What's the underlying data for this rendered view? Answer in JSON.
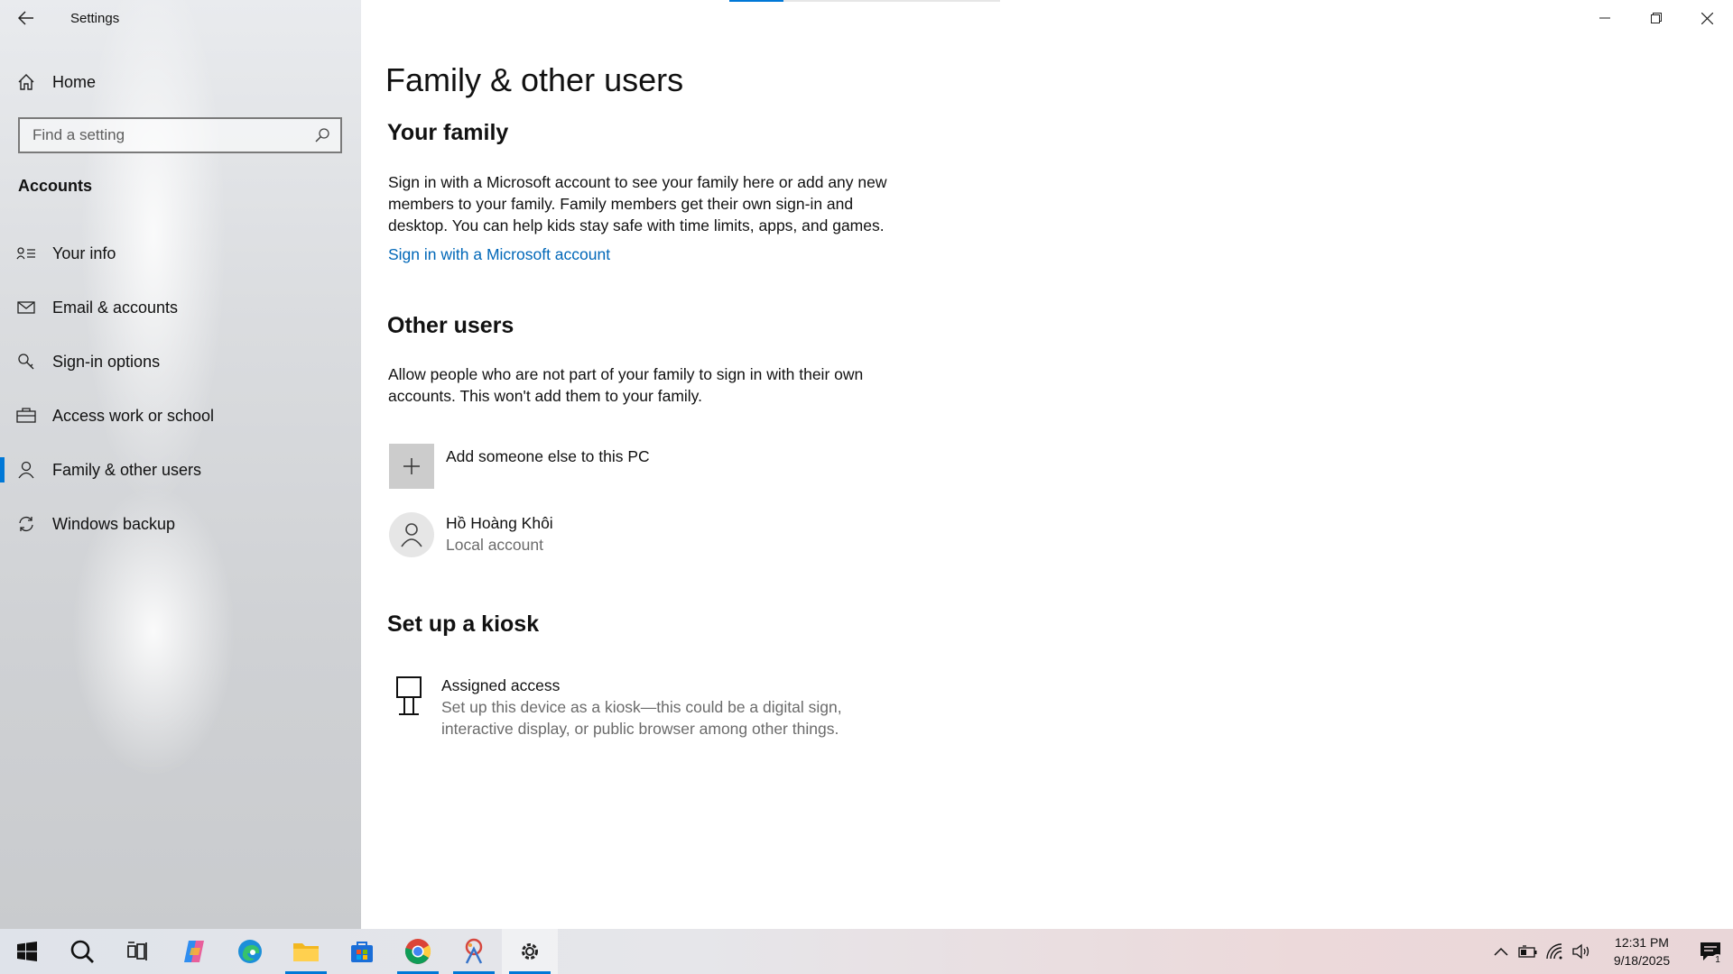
{
  "window": {
    "title": "Settings"
  },
  "sidebar": {
    "home_label": "Home",
    "search_placeholder": "Find a setting",
    "section_heading": "Accounts",
    "items": [
      {
        "label": "Your info",
        "icon": "contact-card-icon"
      },
      {
        "label": "Email & accounts",
        "icon": "mail-icon"
      },
      {
        "label": "Sign-in options",
        "icon": "key-icon"
      },
      {
        "label": "Access work or school",
        "icon": "briefcase-icon"
      },
      {
        "label": "Family & other users",
        "icon": "person-icon",
        "active": true
      },
      {
        "label": "Windows backup",
        "icon": "sync-icon"
      }
    ]
  },
  "main": {
    "page_title": "Family & other users",
    "your_family": {
      "heading": "Your family",
      "description": "Sign in with a Microsoft account to see your family here or add any new members to your family. Family members get their own sign-in and desktop. You can help kids stay safe with time limits, apps, and games.",
      "link": "Sign in with a Microsoft account"
    },
    "other_users": {
      "heading": "Other users",
      "description": "Allow people who are not part of your family to sign in with their own accounts. This won't add them to your family.",
      "add_label": "Add someone else to this PC",
      "user": {
        "name": "Hồ Hoàng Khôi",
        "type": "Local account"
      }
    },
    "kiosk": {
      "heading": "Set up a kiosk",
      "title": "Assigned access",
      "description": "Set up this device as a kiosk—this could be a digital sign, interactive display, or public browser among other things."
    }
  },
  "taskbar": {
    "apps": [
      "start",
      "search",
      "task-view",
      "copilot",
      "edge",
      "file-explorer",
      "microsoft-store",
      "chrome",
      "paint",
      "settings"
    ],
    "time": "12:31 PM",
    "date": "9/18/2025",
    "notification_count": "1"
  },
  "colors": {
    "accent": "#0078d7",
    "link": "#0067b8"
  }
}
